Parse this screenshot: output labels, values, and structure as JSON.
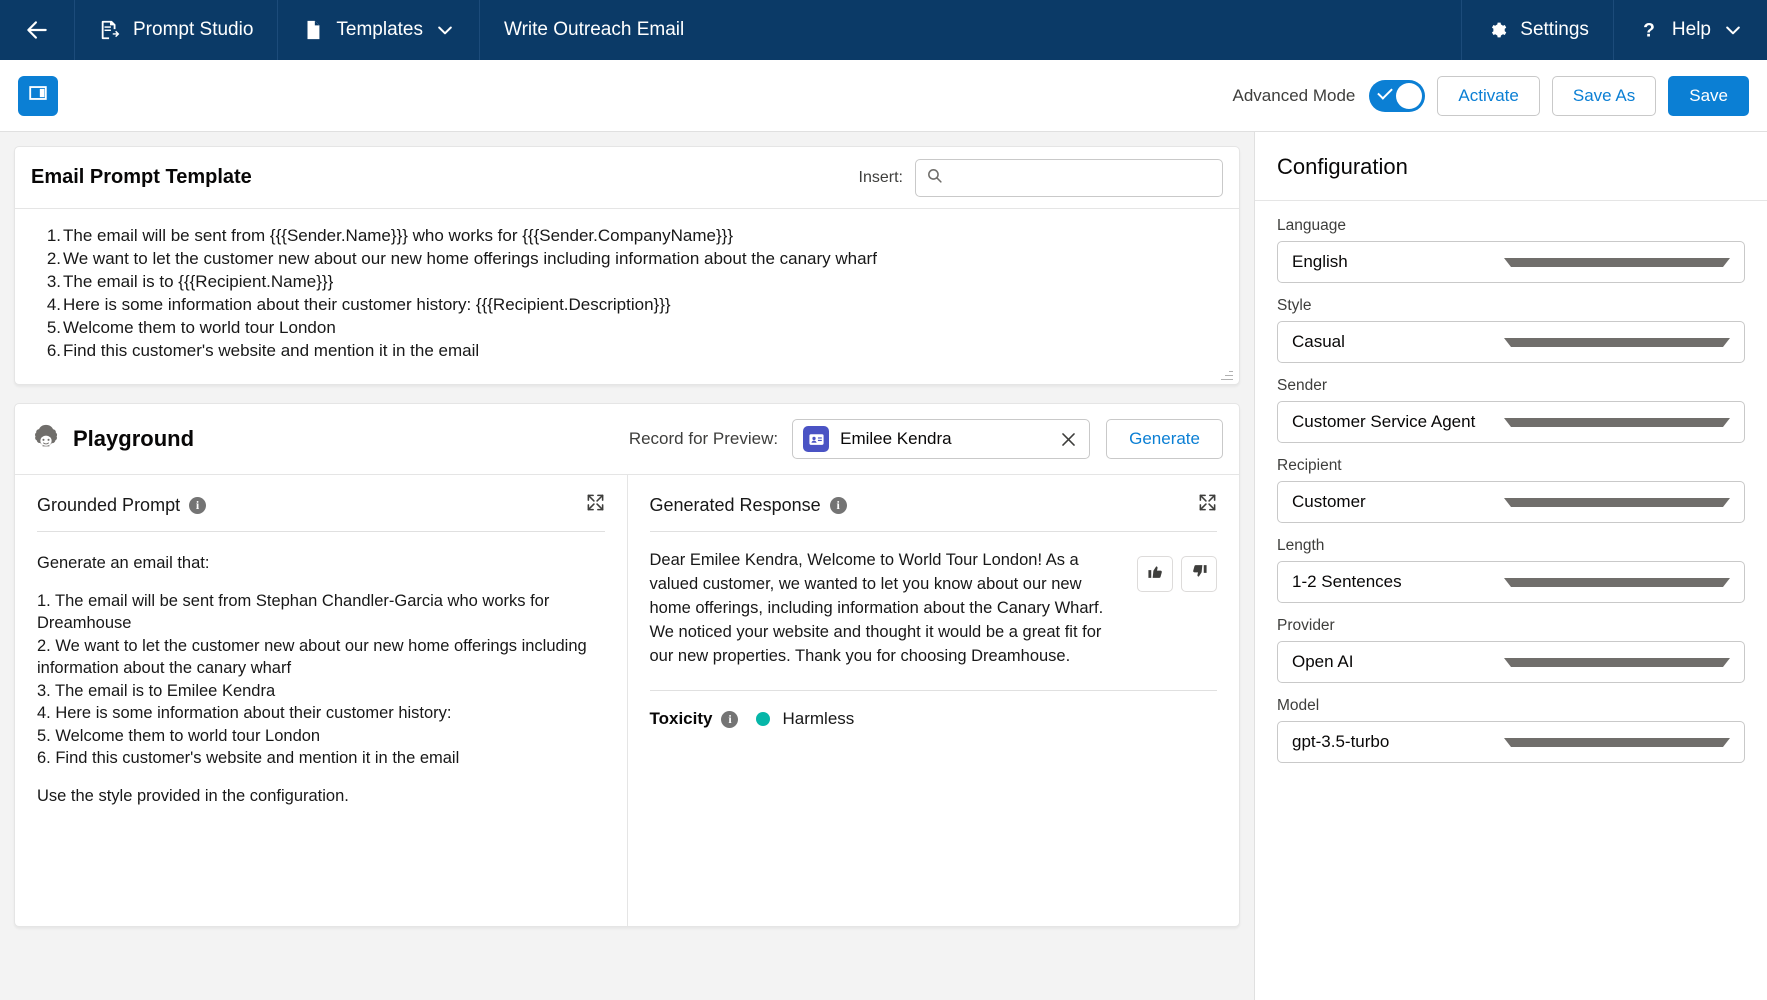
{
  "global_header": {
    "back_icon": "arrow-left-icon",
    "app_name": "Prompt Studio",
    "app_icon": "prompt-studio-icon",
    "templates_label": "Templates",
    "templates_icon": "document-icon",
    "templates_caret": "chevron-down-icon",
    "record_title": "Write Outreach Email",
    "settings_label": "Settings",
    "settings_icon": "gear-icon",
    "help_label": "Help",
    "help_icon": "question-mark-icon",
    "help_caret": "chevron-down-icon"
  },
  "action_bar": {
    "app_badge_icon": "panel-layout-icon",
    "advanced_mode_label": "Advanced Mode",
    "advanced_mode_on": true,
    "activate_label": "Activate",
    "save_as_label": "Save As",
    "save_label": "Save"
  },
  "template_card": {
    "title": "Email Prompt Template",
    "insert_label": "Insert:",
    "search_icon": "search-icon",
    "search_value": "",
    "search_placeholder": "",
    "lines": [
      {
        "num": "1.",
        "text": "The email will be sent from {{{Sender.Name}}} who works for {{{Sender.CompanyName}}}"
      },
      {
        "num": "2.",
        "text": "We want to let the customer new about our new home offerings including information about the canary wharf"
      },
      {
        "num": "3.",
        "text": "The email is to {{{Recipient.Name}}}"
      },
      {
        "num": "4.",
        "text": "Here is some information about their customer history: {{{Recipient.Description}}}"
      },
      {
        "num": "5.",
        "text": "Welcome them to world tour London"
      },
      {
        "num": "6.",
        "text": "Find this customer's website and mention it in the email"
      }
    ]
  },
  "playground": {
    "icon": "einstein-icon",
    "title": "Playground",
    "record_label": "Record for Preview:",
    "record_avatar_icon": "contact-card-icon",
    "record_name": "Emilee Kendra",
    "record_clear_icon": "close-icon",
    "generate_label": "Generate",
    "grounded_prompt": {
      "title": "Grounded Prompt",
      "info_icon": "info-icon",
      "expand_icon": "expand-icon",
      "intro": "Generate an email that:",
      "lines": [
        "1. The email will be sent from Stephan Chandler-Garcia who works for Dreamhouse",
        "2. We want to let the customer new about our new home offerings including information about the canary wharf",
        "3. The email is to Emilee Kendra",
        "4. Here is some information about their customer history:",
        "5. Welcome them to world tour London",
        "6. Find this customer's website and mention it in the email"
      ],
      "outro": "Use the style provided in the configuration."
    },
    "generated_response": {
      "title": "Generated Response",
      "info_icon": "info-icon",
      "expand_icon": "expand-icon",
      "text": "Dear Emilee Kendra, Welcome to World Tour London! As a valued customer, we wanted to let you know about our new home offerings, including information about the Canary Wharf. We noticed your website and thought it would be a great fit for our new properties. Thank you for choosing Dreamhouse.",
      "thumbs_up_icon": "thumbs-up-icon",
      "thumbs_down_icon": "thumbs-down-icon",
      "toxicity_label": "Toxicity",
      "toxicity_info_icon": "info-icon",
      "toxicity_value": "Harmless",
      "toxicity_color": "#06b6a8"
    }
  },
  "configuration": {
    "title": "Configuration",
    "fields": [
      {
        "label": "Language",
        "value": "English"
      },
      {
        "label": "Style",
        "value": "Casual"
      },
      {
        "label": "Sender",
        "value": "Customer Service Agent"
      },
      {
        "label": "Recipient",
        "value": "Customer"
      },
      {
        "label": "Length",
        "value": "1-2 Sentences"
      },
      {
        "label": "Provider",
        "value": "Open AI"
      },
      {
        "label": "Model",
        "value": "gpt-3.5-turbo"
      }
    ]
  },
  "colors": {
    "header_blue": "#0b3a67",
    "brand_blue": "#0b7fd4",
    "avatar_purple": "#4a53c4",
    "status_teal": "#06b6a8"
  }
}
